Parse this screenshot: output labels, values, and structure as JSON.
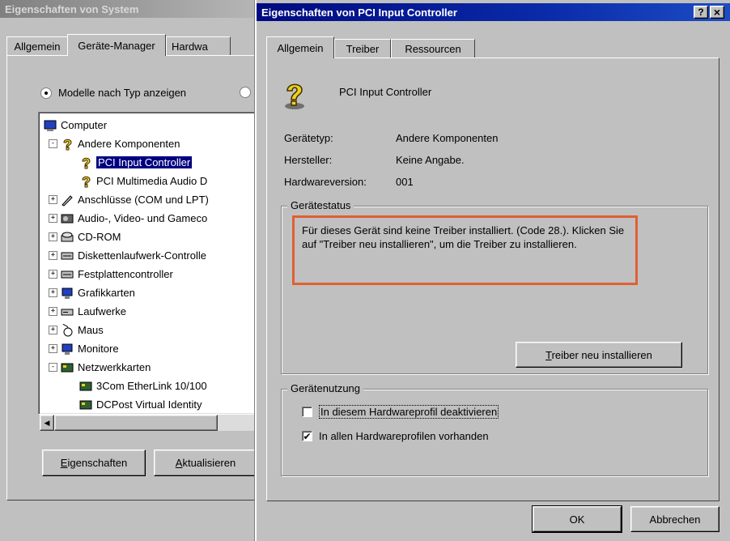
{
  "bg_window": {
    "title": "Eigenschaften von System",
    "tabs": [
      "Allgemein",
      "Geräte-Manager",
      "Hardwa"
    ],
    "radio_label": "Modelle nach Typ anzeigen",
    "tree": [
      {
        "label": "Computer",
        "icon": "computer-icon",
        "level": 0
      },
      {
        "label": "Andere Komponenten",
        "icon": "question-icon",
        "level": 1,
        "expander": "-"
      },
      {
        "label": "PCI Input Controller",
        "icon": "question-icon",
        "level": 2,
        "selected": true
      },
      {
        "label": "PCI Multimedia Audio D",
        "icon": "question-icon",
        "level": 2
      },
      {
        "label": "Anschlüsse (COM und LPT)",
        "icon": "port-icon",
        "level": 1,
        "expander": "+"
      },
      {
        "label": "Audio-, Video- und Gameco",
        "icon": "audio-icon",
        "level": 1,
        "expander": "+"
      },
      {
        "label": "CD-ROM",
        "icon": "cdrom-icon",
        "level": 1,
        "expander": "+"
      },
      {
        "label": "Diskettenlaufwerk-Controlle",
        "icon": "floppy-controller-icon",
        "level": 1,
        "expander": "+"
      },
      {
        "label": "Festplattencontroller",
        "icon": "harddisk-controller-icon",
        "level": 1,
        "expander": "+"
      },
      {
        "label": "Grafikkarten",
        "icon": "monitor-icon",
        "level": 1,
        "expander": "+"
      },
      {
        "label": "Laufwerke",
        "icon": "drive-icon",
        "level": 1,
        "expander": "+"
      },
      {
        "label": "Maus",
        "icon": "mouse-icon",
        "level": 1,
        "expander": "+"
      },
      {
        "label": "Monitore",
        "icon": "monitor-icon",
        "level": 1,
        "expander": "+"
      },
      {
        "label": "Netzwerkkarten",
        "icon": "network-icon",
        "level": 1,
        "expander": "-"
      },
      {
        "label": "3Com EtherLink 10/100",
        "icon": "network-icon",
        "level": 2
      },
      {
        "label": "DCPost Virtual Identity",
        "icon": "network-icon",
        "level": 2
      }
    ],
    "btn_properties": "Eigenschaften",
    "btn_refresh": "Aktualisieren"
  },
  "dialog": {
    "title": "Eigenschaften von PCI Input Controller",
    "help_glyph": "?",
    "close_glyph": "×",
    "tabs": [
      "Allgemein",
      "Treiber",
      "Ressourcen"
    ],
    "device_name": "PCI Input Controller",
    "device_icon": "question-icon",
    "props": [
      {
        "label": "Gerätetyp:",
        "value": "Andere Komponenten"
      },
      {
        "label": "Hersteller:",
        "value": "Keine Angabe."
      },
      {
        "label": "Hardwareversion:",
        "value": "001"
      }
    ],
    "status_group": "Gerätestatus",
    "status_text": "Für dieses Gerät sind keine Treiber installiert. (Code 28.). Klicken Sie auf \"Treiber neu installieren\", um die Treiber zu installieren.",
    "reinstall_button": "Treiber neu installieren",
    "usage_group": "Gerätenutzung",
    "checkbox1": {
      "label": "In diesem Hardwareprofil deaktivieren",
      "checked": false
    },
    "checkbox2": {
      "label": "In allen Hardwareprofilen vorhanden",
      "checked": true
    },
    "ok": "OK",
    "cancel": "Abbrechen",
    "highlight_color": "#e06030"
  }
}
